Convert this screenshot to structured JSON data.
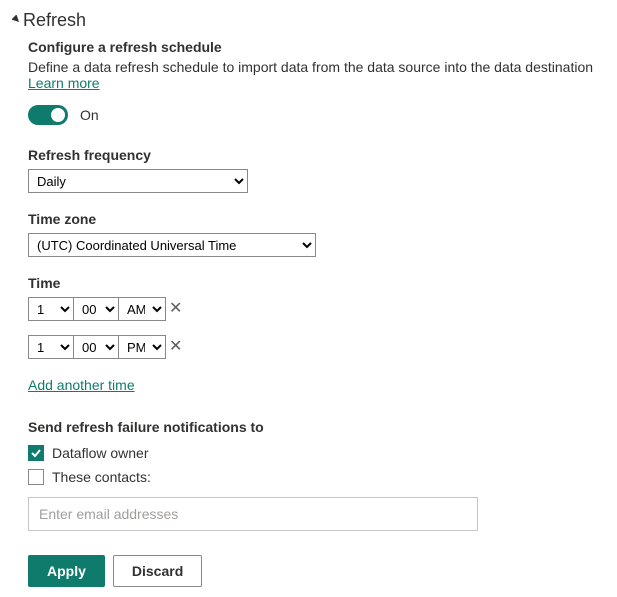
{
  "section": {
    "title": "Refresh",
    "subtitle": "Configure a refresh schedule",
    "description": "Define a data refresh schedule to import data from the data source into the data destination ",
    "learn_more": "Learn more"
  },
  "toggle": {
    "label": "On",
    "enabled": true
  },
  "frequency": {
    "label": "Refresh frequency",
    "value": "Daily"
  },
  "timezone": {
    "label": "Time zone",
    "value": "(UTC) Coordinated Universal Time"
  },
  "time": {
    "label": "Time",
    "rows": [
      {
        "hour": "1",
        "minute": "00",
        "ampm": "AM"
      },
      {
        "hour": "1",
        "minute": "00",
        "ampm": "PM"
      }
    ],
    "add_link": "Add another time"
  },
  "notifications": {
    "label": "Send refresh failure notifications to",
    "owner_label": "Dataflow owner",
    "owner_checked": true,
    "contacts_label": "These contacts:",
    "contacts_checked": false,
    "email_placeholder": "Enter email addresses"
  },
  "buttons": {
    "apply": "Apply",
    "discard": "Discard"
  }
}
